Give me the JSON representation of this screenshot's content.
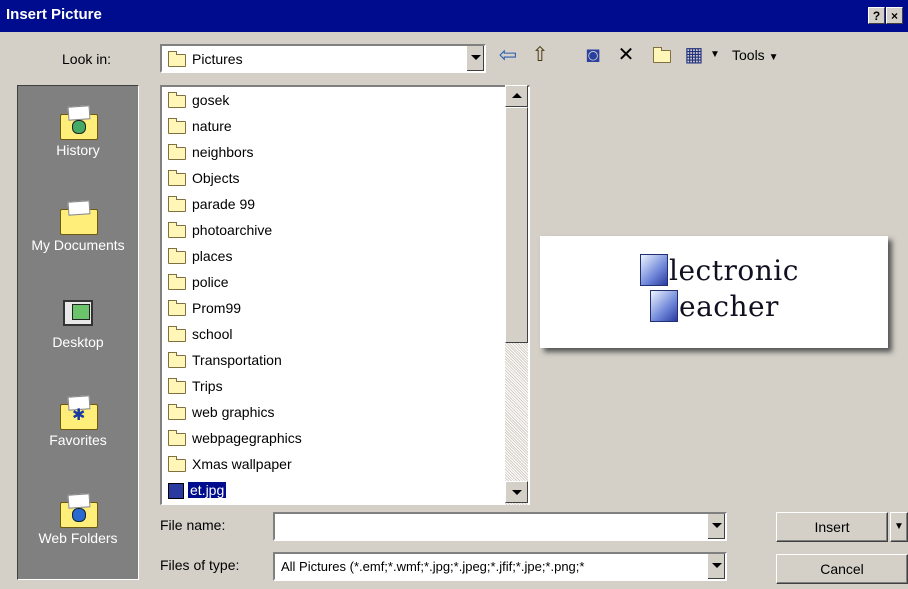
{
  "window": {
    "title": "Insert Picture",
    "help_glyph": "?",
    "close_glyph": "×"
  },
  "look_in": {
    "label": "Look in:",
    "value": "Pictures"
  },
  "toolbar": {
    "back_glyph": "⇦",
    "up_glyph": "⇧",
    "search_glyph": "◙",
    "delete_glyph": "✕",
    "views_glyph": "▦",
    "tools_label": "Tools"
  },
  "places": [
    {
      "label": "History",
      "icon": "history-icon"
    },
    {
      "label": "My Documents",
      "icon": "my-documents-icon"
    },
    {
      "label": "Desktop",
      "icon": "desktop-icon"
    },
    {
      "label": "Favorites",
      "icon": "favorites-icon"
    },
    {
      "label": "Web Folders",
      "icon": "web-folders-icon"
    }
  ],
  "files": [
    {
      "name": "gosek"
    },
    {
      "name": "nature"
    },
    {
      "name": "neighbors"
    },
    {
      "name": "Objects"
    },
    {
      "name": "parade 99"
    },
    {
      "name": "photoarchive"
    },
    {
      "name": "places"
    },
    {
      "name": "police"
    },
    {
      "name": "Prom99"
    },
    {
      "name": "school"
    },
    {
      "name": "Transportation"
    },
    {
      "name": "Trips"
    },
    {
      "name": "web graphics"
    },
    {
      "name": "webpagegraphics"
    },
    {
      "name": "Xmas wallpaper"
    },
    {
      "name": "et.jpg",
      "selected": true
    }
  ],
  "preview": {
    "line1": "lectronic",
    "line2": "eacher"
  },
  "file_name": {
    "label": "File name:",
    "value": ""
  },
  "files_of_type": {
    "label": "Files of type:",
    "value": "All Pictures (*.emf;*.wmf;*.jpg;*.jpeg;*.jfif;*.jpe;*.png;*"
  },
  "buttons": {
    "insert": "Insert",
    "cancel": "Cancel"
  }
}
